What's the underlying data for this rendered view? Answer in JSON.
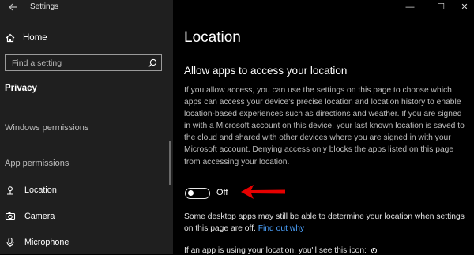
{
  "window": {
    "app_title": "Settings",
    "controls": {
      "minimize": "—",
      "maximize": "☐",
      "close": "✕"
    }
  },
  "sidebar": {
    "home_label": "Home",
    "search_placeholder": "Find a setting",
    "section": "Privacy",
    "windows_permissions": "Windows permissions",
    "app_permissions": "App permissions",
    "items": [
      {
        "label": "Location",
        "icon": "location-icon"
      },
      {
        "label": "Camera",
        "icon": "camera-icon"
      },
      {
        "label": "Microphone",
        "icon": "microphone-icon"
      }
    ]
  },
  "main": {
    "title": "Location",
    "heading": "Allow apps to access your location",
    "description": "If you allow access, you can use the settings on this page to choose which apps can access your device's precise location and location history to enable location-based experiences such as directions and weather. If you are signed in with a Microsoft account on this device, your last known location is saved to the cloud and shared with other devices where you are signed in with your Microsoft account. Denying access only blocks the apps listed on this page from accessing your location.",
    "toggle_state": "Off",
    "note_text": "Some desktop apps may still be able to determine your location when settings on this page are off.",
    "note_link": "Find out why",
    "bottom_text": "If an app is using your location, you'll see this icon:"
  },
  "colors": {
    "sidebar_bg": "#1f1f1f",
    "main_bg": "#000000",
    "link": "#4da3ff",
    "annotation_arrow": "#e60000"
  }
}
